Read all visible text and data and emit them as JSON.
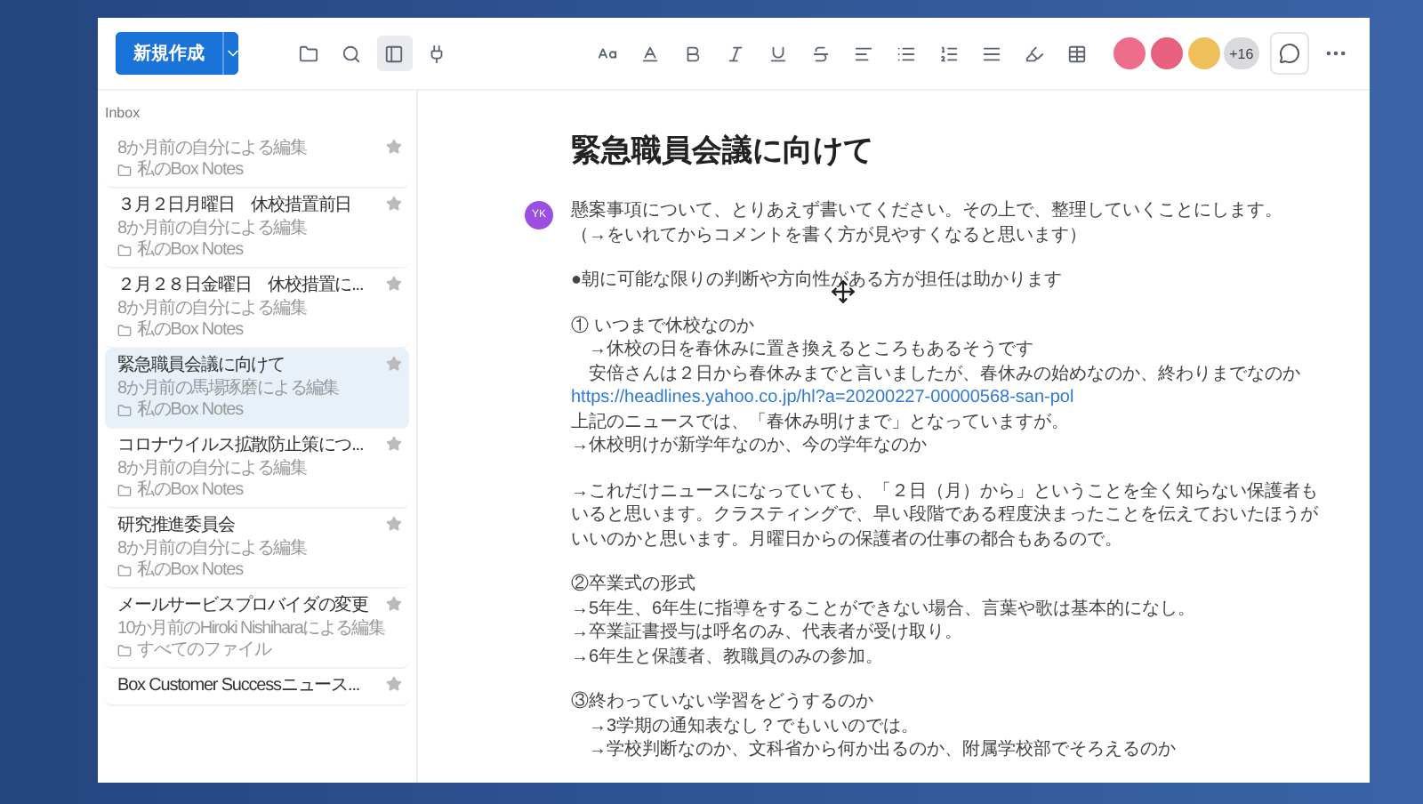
{
  "toolbar": {
    "new_button": "新規作成",
    "avatars": [
      {
        "color": "#ee6d8a"
      },
      {
        "color": "#e8627f"
      },
      {
        "color": "#eec05a"
      }
    ],
    "more_count": "+16"
  },
  "sidebar": {
    "heading": "Inbox",
    "items": [
      {
        "subtitle": "8か月前の自分による編集",
        "folder": "私のBox Notes",
        "selected": false
      },
      {
        "title": "３月２日月曜日　休校措置前日",
        "subtitle": "8か月前の自分による編集",
        "folder": "私のBox Notes",
        "selected": false
      },
      {
        "title": "２月２８日金曜日　休校措置に...",
        "subtitle": "8か月前の自分による編集",
        "folder": "私のBox Notes",
        "selected": false
      },
      {
        "title": "緊急職員会議に向けて",
        "subtitle": "8か月前の馬場琢磨による編集",
        "folder": "私のBox Notes",
        "selected": true
      },
      {
        "title": "コロナウイルス拡散防止策につ...",
        "subtitle": "8か月前の自分による編集",
        "folder": "私のBox Notes",
        "selected": false
      },
      {
        "title": "研究推進委員会",
        "subtitle": "8か月前の自分による編集",
        "folder": "私のBox Notes",
        "selected": false
      },
      {
        "title": "メールサービスプロバイダの変更",
        "subtitle": "10か月前のHiroki Nishiharaによる編集",
        "folder": "すべてのファイル",
        "selected": false
      },
      {
        "title": "Box Customer Successニュース...",
        "selected": false
      }
    ]
  },
  "document": {
    "title": "緊急職員会議に向けて",
    "author_initials": "YK",
    "blocks": [
      {
        "lines": [
          {
            "kind": "text",
            "text": "懸案事項について、とりあえず書いてください。その上で、整理していくことにします。"
          },
          {
            "kind": "text",
            "text": "（→をいれてからコメントを書く方が見やすくなると思います）"
          }
        ]
      },
      {
        "lines": [
          {
            "kind": "text",
            "text": "●朝に可能な限りの判断や方向性がある方が担任は助かります"
          }
        ]
      },
      {
        "lines": [
          {
            "kind": "text",
            "text": "① いつまで休校なのか"
          },
          {
            "kind": "indent",
            "text": "→休校の日を春休みに置き換えるところもあるそうです"
          },
          {
            "kind": "indent",
            "text": "安倍さんは２日から春休みまでと言いましたが、春休みの始めなのか、終わりまでなのか"
          },
          {
            "kind": "link",
            "text": "https://headlines.yahoo.co.jp/hl?a=20200227-00000568-san-pol"
          },
          {
            "kind": "text",
            "text": "上記のニュースでは、「春休み明けまで」となっていますが。"
          },
          {
            "kind": "text",
            "text": "→休校明けが新学年なのか、今の学年なのか"
          }
        ]
      },
      {
        "lines": [
          {
            "kind": "text",
            "text": "→これだけニュースになっていても、「２日（月）から」ということを全く知らない保護者もいると思います。クラスティングで、早い段階である程度決まったことを伝えておいたほうがいいのかと思います。月曜日からの保護者の仕事の都合もあるので。"
          }
        ]
      },
      {
        "lines": [
          {
            "kind": "text",
            "text": "②卒業式の形式"
          },
          {
            "kind": "text",
            "text": "→5年生、6年生に指導をすることができない場合、言葉や歌は基本的になし。"
          },
          {
            "kind": "text",
            "text": "→卒業証書授与は呼名のみ、代表者が受け取り。"
          },
          {
            "kind": "text",
            "text": "→6年生と保護者、教職員のみの参加。"
          }
        ]
      },
      {
        "lines": [
          {
            "kind": "text",
            "text": "③終わっていない学習をどうするのか"
          },
          {
            "kind": "indent",
            "text": "→3学期の通知表なし？でもいいのでは。"
          },
          {
            "kind": "indent",
            "text": "→学校判断なのか、文科省から何か出るのか、附属学校部でそろえるのか"
          }
        ]
      }
    ]
  }
}
